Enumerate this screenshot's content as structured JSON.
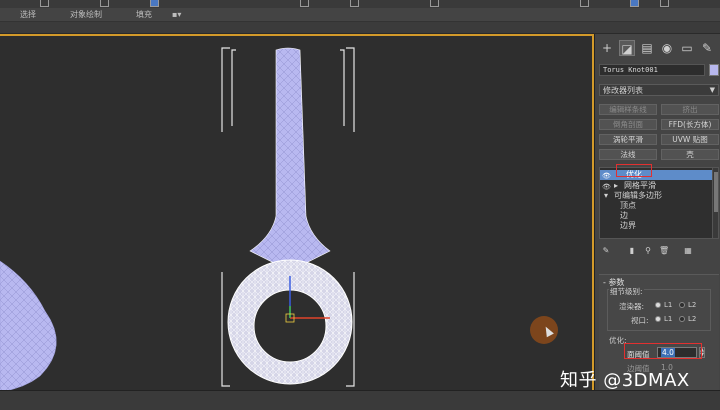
{
  "menu": {
    "items": [
      {
        "id": "select",
        "label": "选择"
      },
      {
        "id": "object_paint",
        "label": "对象绘制"
      },
      {
        "id": "populate",
        "label": "填充"
      }
    ]
  },
  "command_panel": {
    "object_name": "Torus Knot001",
    "object_color": "#b8b8ee",
    "modifier_list": {
      "label": "修改器列表"
    },
    "modifier_buttons": [
      {
        "id": "edit_poly",
        "label": "编辑样条线",
        "enabled": false
      },
      {
        "id": "extrude",
        "label": "挤出",
        "enabled": false
      },
      {
        "id": "lathe",
        "label": "倒角剖面",
        "enabled": false
      },
      {
        "id": "ffd",
        "label": "FFD(长方体)",
        "enabled": true
      },
      {
        "id": "turbosmooth",
        "label": "涡轮平滑",
        "enabled": true
      },
      {
        "id": "uvw",
        "label": "UVW 贴图",
        "enabled": true
      },
      {
        "id": "normal",
        "label": "法线",
        "enabled": true
      },
      {
        "id": "shell",
        "label": "壳",
        "enabled": true
      }
    ],
    "stack": [
      {
        "label": "优化",
        "selected": true,
        "eye": true
      },
      {
        "label": "网格平滑",
        "selected": false,
        "eye": true
      },
      {
        "label": "可编辑多边形",
        "selected": false,
        "eye": false
      },
      {
        "label": "顶点",
        "selected": false,
        "sub": true
      },
      {
        "label": "边",
        "selected": false,
        "sub": true
      },
      {
        "label": "边界",
        "selected": false,
        "sub": true
      }
    ],
    "parameters": {
      "title": "参数",
      "detail_level": {
        "title": "细节级别:",
        "renderer": {
          "label": "渲染器:",
          "options": [
            "L1",
            "L2"
          ],
          "selected": "L1"
        },
        "viewport": {
          "label": "视口:",
          "options": [
            "L1",
            "L2"
          ],
          "selected": "L1"
        }
      },
      "optimize": {
        "title": "优化:",
        "face_threshold": {
          "label": "面阈值",
          "value": "4.0"
        },
        "edge_threshold": {
          "label": "边阈值",
          "value": "1.0"
        }
      }
    }
  },
  "watermark": "知乎 @3DMAX",
  "colors": {
    "viewport_border": "#d39a2a",
    "mesh_fill": "#b8b8f0",
    "highlight_box": "#e23030",
    "selected_row": "#5e8cc9"
  }
}
